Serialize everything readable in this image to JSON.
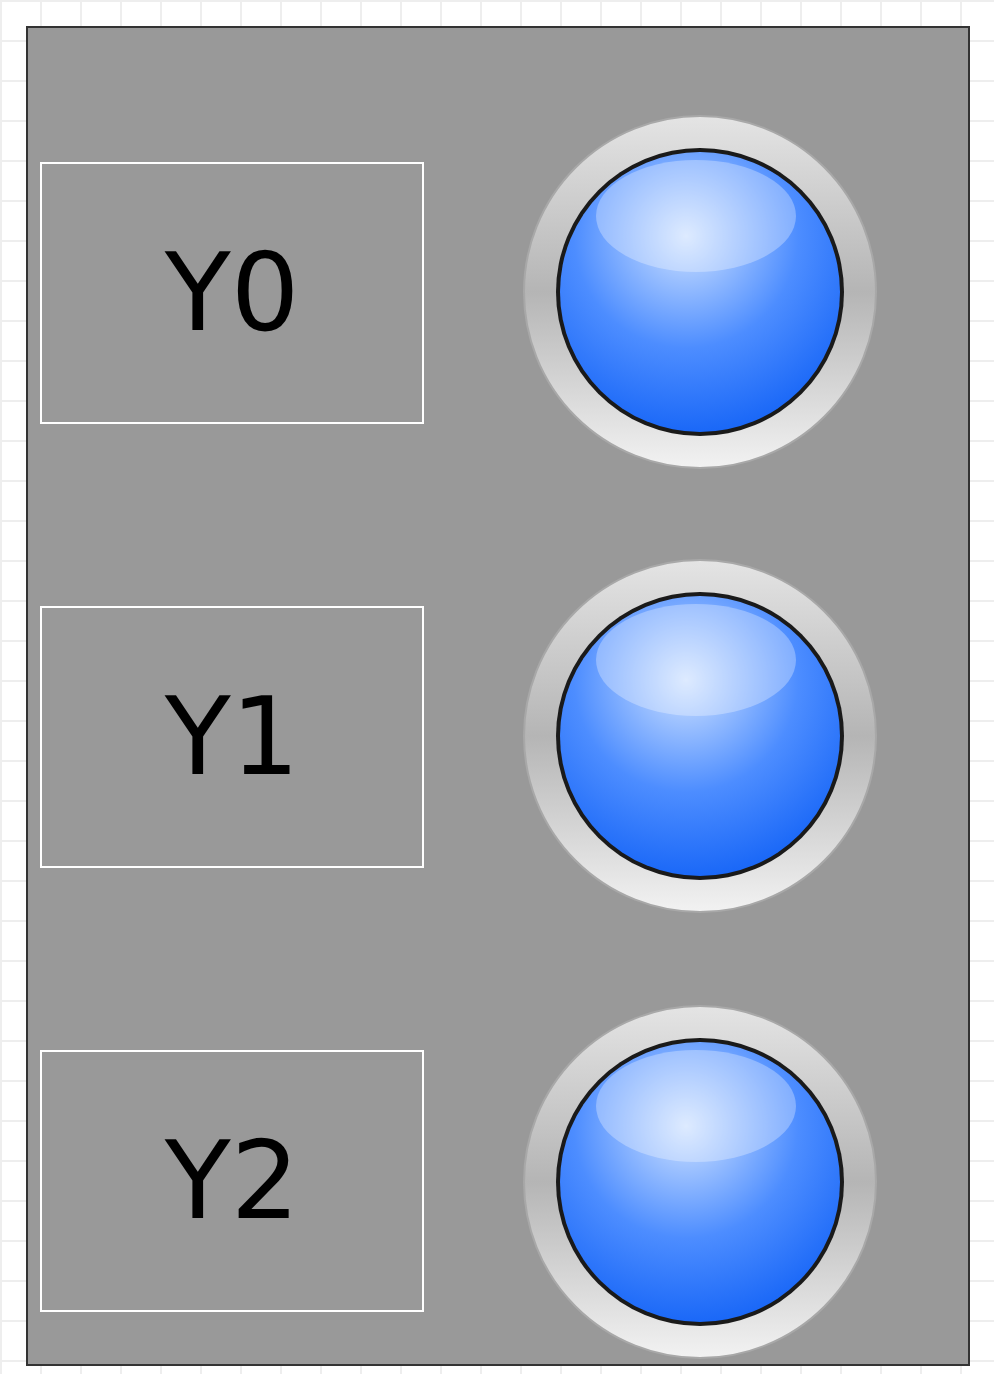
{
  "indicators": [
    {
      "label": "Y0",
      "on": true
    },
    {
      "label": "Y1",
      "on": true
    },
    {
      "label": "Y2",
      "on": true
    }
  ]
}
